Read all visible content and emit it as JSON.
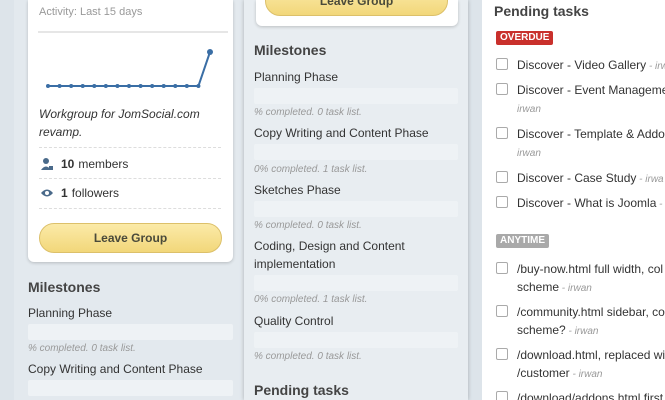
{
  "left_card": {
    "activity_label": "Activity: Last 15 days",
    "sparkline_values": [
      0,
      0,
      0,
      0,
      0,
      0,
      0,
      0,
      0,
      0,
      0,
      0,
      0,
      0,
      1
    ],
    "description": "Workgroup for JomSocial.com revamp.",
    "members_count": "10",
    "members_label": "members",
    "followers_count": "1",
    "followers_label": "followers",
    "leave_label": "Leave Group"
  },
  "left_milestones": {
    "title": "Milestones",
    "items": [
      {
        "name": "Planning Phase",
        "status": "% completed. 0 task list."
      },
      {
        "name": "Copy Writing and Content Phase",
        "status": ""
      }
    ]
  },
  "middle": {
    "leave_label": "Leave Group",
    "milestones_title": "Milestones",
    "milestones": [
      {
        "name": "Planning Phase",
        "status": "% completed. 0 task list."
      },
      {
        "name": "Copy Writing and Content Phase",
        "status": "0% completed. 1 task list."
      },
      {
        "name": "Sketches Phase",
        "status": "% completed. 0 task list."
      },
      {
        "name": "Coding, Design and Content implementation",
        "status": "0% completed. 1 task list."
      },
      {
        "name": "Quality Control",
        "status": "% completed. 0 task list."
      }
    ],
    "pending_title": "Pending tasks"
  },
  "right": {
    "pending_title": "Pending tasks",
    "overdue_label": "OVERDUE",
    "anytime_label": "ANYTIME",
    "overdue_tasks": [
      {
        "line1": "Discover - Video Gallery",
        "author": " - irw",
        "line2": ""
      },
      {
        "line1": "Discover - Event Manageme",
        "author": "",
        "line2": "irwan"
      },
      {
        "line1": "Discover - Template & Addo",
        "author": "",
        "line2": "irwan"
      },
      {
        "line1": "Discover - Case Study",
        "author": " - irwa",
        "line2": ""
      },
      {
        "line1": "Discover - What is Joomla",
        "author": " -",
        "line2": ""
      }
    ],
    "anytime_tasks": [
      {
        "line1": "/buy-now.html full width, col",
        "line2": "scheme",
        "author": " - irwan"
      },
      {
        "line1": "/community.html sidebar, co",
        "line2": "scheme?",
        "author": " - irwan"
      },
      {
        "line1": "/download.html, replaced wi",
        "line2": "/customer",
        "author": " - irwan"
      },
      {
        "line1": "/download/addons.html first",
        "line2": "",
        "author": ""
      }
    ]
  },
  "colors": {
    "overdue": "#c9302c",
    "anytime": "#a9a9a9",
    "button": "#f2d77a",
    "sparkline": "#3a6ea5"
  }
}
